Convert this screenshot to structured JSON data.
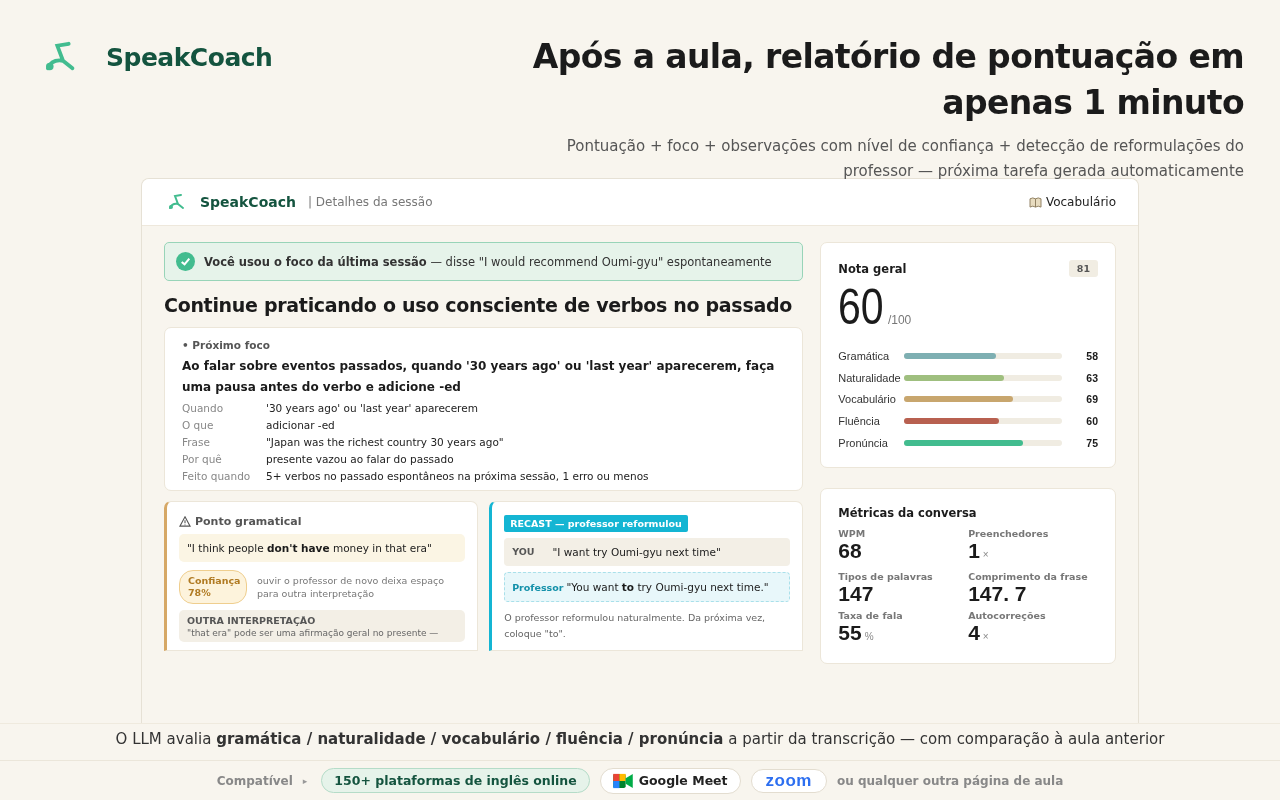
{
  "brand": {
    "name": "SpeakCoach"
  },
  "hero": {
    "title": "Após a aula, **relatório de pontuação em apenas 1 minuto**",
    "subtitle": "Pontuação + foco + observações com nível de confiança + detecção de reformulações do professor — próxima tarefa gerada automaticamente"
  },
  "app": {
    "brand": "SpeakCoach",
    "section": "| Detalhes da sessão",
    "vocab_link": "Vocabulário",
    "banner": "**Você usou o foco da última sessão** — disse \"I would recommend Oumi-gyu\" espontaneamente",
    "heading": "Continue praticando o uso consciente de verbos no passado",
    "focus": {
      "tag": "• Próximo foco",
      "title": "Ao falar sobre eventos passados, quando '30 years ago' ou 'last year' aparecerem, faça uma pausa antes do verbo e adicione -ed",
      "rows": [
        {
          "label": "Quando",
          "value": "'30 years ago' ou 'last year' aparecerem"
        },
        {
          "label": "O que",
          "value": "adicionar -ed"
        },
        {
          "label": "Frase",
          "value": "\"Japan was the richest country 30 years ago\""
        },
        {
          "label": "Por quê",
          "value": "presente vazou ao falar do passado"
        },
        {
          "label": "Feito quando",
          "value": "5+ verbos no passado espontâneos na próxima sessão, 1 erro ou menos"
        }
      ]
    },
    "grammar": {
      "title": "Ponto gramatical",
      "quote": "\"I think people **don't have** money in that era\"",
      "confidence": "Confiança 78%",
      "confidence_note": "ouvir o professor de novo deixa espaço para outra interpretação",
      "alt_title": "OUTRA INTERPRETAÇÃO",
      "alt_text": "\"that era\" pode ser uma afirmação geral no presente —"
    },
    "recast": {
      "badge": "RECAST — professor reformulou",
      "you_label": "YOU",
      "you_text": "\"I want try Oumi-gyu next time\"",
      "prof_label": "Professor",
      "prof_text": "\"You want **to** try Oumi-gyu next time.\"",
      "note": "O professor reformulou naturalmente. Da próxima vez, coloque \"to\"."
    },
    "score": {
      "title": "Nota geral",
      "badge": "81",
      "value": "60",
      "max": "/100",
      "bars": [
        {
          "label": "Gramática",
          "level": 0.58,
          "value": "58",
          "color": "#7eafb2"
        },
        {
          "label": "Naturalidade",
          "level": 0.63,
          "value": "63",
          "color": "#9fbf7f"
        },
        {
          "label": "Vocabulário",
          "level": 0.69,
          "value": "69",
          "color": "#c8a66e"
        },
        {
          "label": "Fluência",
          "level": 0.6,
          "value": "60",
          "color": "#b86050"
        },
        {
          "label": "Pronúncia",
          "level": 0.75,
          "value": "75",
          "color": "#42bc8f"
        }
      ]
    },
    "metrics": {
      "title": "Métricas da conversa",
      "items": [
        {
          "label": "WPM",
          "value": "68"
        },
        {
          "label": "Preenchedores",
          "value": "1",
          "unit": "×"
        },
        {
          "label": "Tipos de palavras",
          "value": "147"
        },
        {
          "label": "Comprimento da frase",
          "value": "147. 7"
        },
        {
          "label": "Taxa de fala",
          "value": "55",
          "unit": "%"
        },
        {
          "label": "Autocorreções",
          "value": "4",
          "unit": "×"
        }
      ]
    }
  },
  "footer": {
    "summary": "O LLM avalia **gramática / naturalidade / vocabulário / fluência / pronúncia** a partir da transcrição — com comparação à aula anterior",
    "compat": "Compatível",
    "caret": "▸",
    "platforms": "150+ plataformas de inglês online",
    "meet": "Google Meet",
    "zoom": "zoom",
    "other": "ou qualquer outra página de aula"
  }
}
